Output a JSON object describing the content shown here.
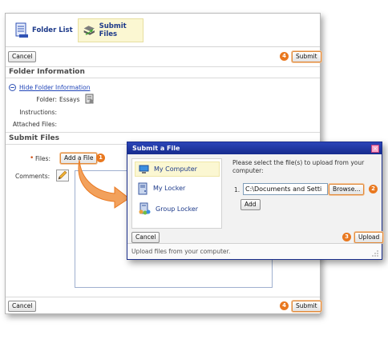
{
  "tabs": [
    {
      "label": "Folder List",
      "icon": "folder-list-icon"
    },
    {
      "label": "Submit Files",
      "icon": "submit-files-icon"
    }
  ],
  "toolbar": {
    "cancel_label": "Cancel",
    "submit_label": "Submit",
    "submit_badge": "4"
  },
  "folder_info": {
    "heading": "Folder Information",
    "toggle_link": "Hide Folder Information",
    "folder_label": "Folder:",
    "folder_value": "Essays",
    "instructions_label": "Instructions:",
    "attached_label": "Attached Files:"
  },
  "submit_files": {
    "heading": "Submit Files",
    "files_label": "Files:",
    "required_marker": "•",
    "add_file_label": "Add a File",
    "add_file_badge": "1",
    "comments_label": "Comments:"
  },
  "dialog": {
    "title": "Submit a File",
    "close_glyph": "×",
    "sources": [
      {
        "label": "My Computer",
        "icon": "computer-icon"
      },
      {
        "label": "My Locker",
        "icon": "locker-icon"
      },
      {
        "label": "Group Locker",
        "icon": "group-locker-icon"
      }
    ],
    "instruction": "Please select the file(s) to upload from your computer:",
    "file_row_number": "1.",
    "file_path": "C:\\Documents and Setti",
    "browse_label": "Browse...",
    "browse_badge": "2",
    "add_label": "Add",
    "cancel_label": "Cancel",
    "upload_label": "Upload",
    "upload_badge": "3",
    "status_text": "Upload files from your computer."
  },
  "colors": {
    "accent": "#e9781f",
    "title_bar": "#1b2f8c",
    "highlight": "#fbf7d2",
    "link": "#1f44b8"
  }
}
